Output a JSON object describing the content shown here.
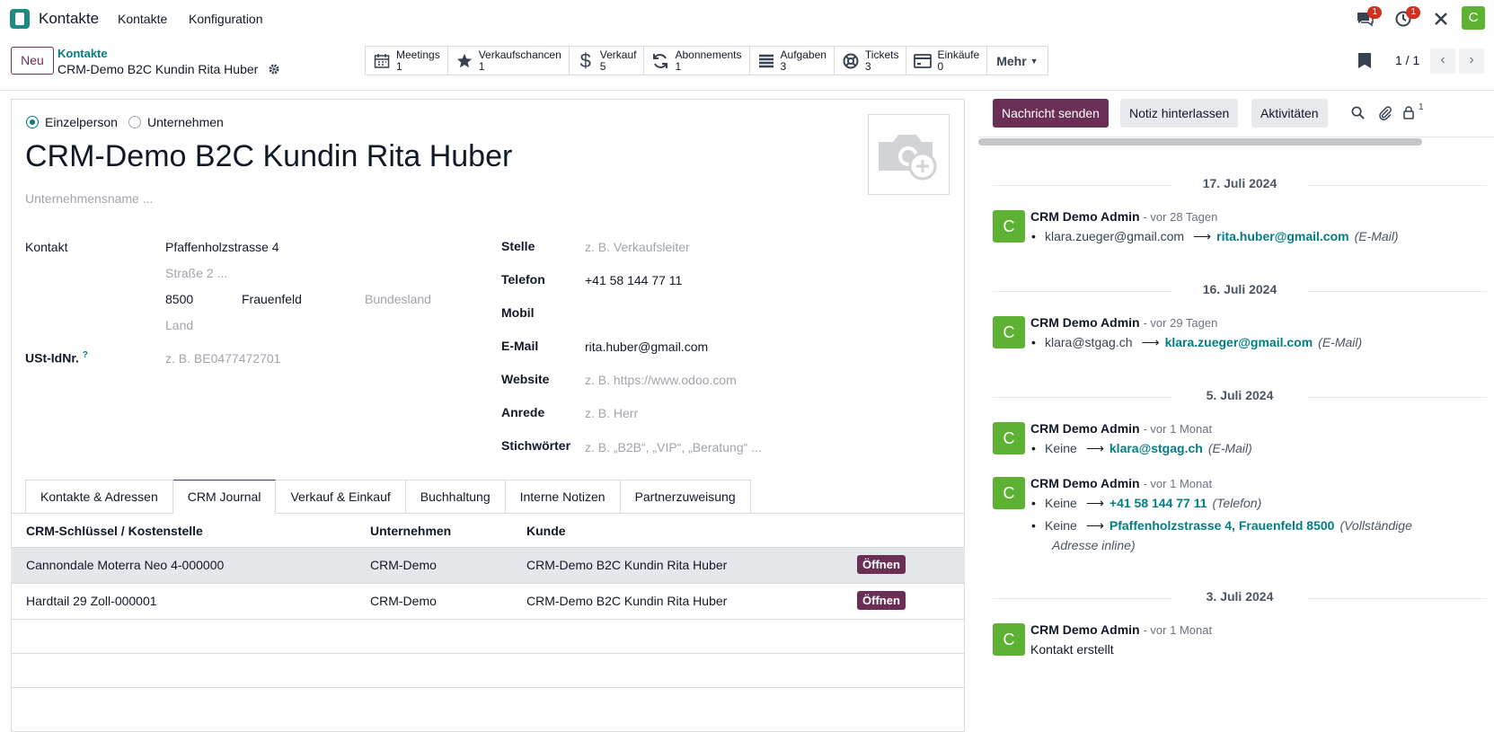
{
  "nav": {
    "app_name": "Kontakte",
    "menu": [
      "Kontakte",
      "Konfiguration"
    ],
    "messages_badge": "1",
    "activity_badge": "1",
    "user_initial": "C"
  },
  "control": {
    "new_label": "Neu",
    "breadcrumb_parent": "Kontakte",
    "breadcrumb_current": "CRM-Demo B2C Kundin Rita Huber",
    "smart_buttons": [
      {
        "label": "Meetings",
        "count": "1",
        "icon": "calendar-icon"
      },
      {
        "label": "Verkaufschancen",
        "count": "1",
        "icon": "star-icon"
      },
      {
        "label": "Verkauf",
        "count": "5",
        "icon": "dollar-icon"
      },
      {
        "label": "Abonnements",
        "count": "1",
        "icon": "refresh-icon"
      },
      {
        "label": "Aufgaben",
        "count": "3",
        "icon": "tasks-icon"
      },
      {
        "label": "Tickets",
        "count": "3",
        "icon": "lifebuoy-icon"
      },
      {
        "label": "Einkäufe",
        "count": "0",
        "icon": "credit-card-icon"
      }
    ],
    "more_label": "Mehr",
    "pager": "1 / 1"
  },
  "form": {
    "type_individual": "Einzelperson",
    "type_company": "Unternehmen",
    "name": "CRM-Demo B2C Kundin Rita Huber",
    "company_placeholder": "Unternehmensname ...",
    "contact_label": "Kontakt",
    "street": "Pfaffenholzstrasse 4",
    "street2_placeholder": "Straße 2 ...",
    "zip": "8500",
    "city": "Frauenfeld",
    "state_placeholder": "Bundesland",
    "country_placeholder": "Land",
    "vat_label": "USt-IdNr.",
    "vat_help": "?",
    "vat_placeholder": "z. B. BE0477472701",
    "job_label": "Stelle",
    "job_placeholder": "z. B. Verkaufsleiter",
    "phone_label": "Telefon",
    "phone": "+41 58 144 77 11",
    "mobile_label": "Mobil",
    "email_label": "E-Mail",
    "email": "rita.huber@gmail.com",
    "website_label": "Website",
    "website_placeholder": "z. B. https://www.odoo.com",
    "title_label": "Anrede",
    "title_placeholder": "z. B. Herr",
    "tags_label": "Stichwörter",
    "tags_placeholder": "z. B. „B2B“, „VIP“, „Beratung“ ..."
  },
  "tabs": [
    "Kontakte & Adressen",
    "CRM Journal",
    "Verkauf & Einkauf",
    "Buchhaltung",
    "Interne Notizen",
    "Partnerzuweisung"
  ],
  "active_tab": "CRM Journal",
  "table": {
    "headers": [
      "CRM-Schlüssel / Kostenstelle",
      "Unternehmen",
      "Kunde"
    ],
    "rows": [
      {
        "key": "Cannondale Moterra Neo 4-000000",
        "company": "CRM-Demo",
        "customer": "CRM-Demo B2C Kundin Rita Huber",
        "action": "Öffnen"
      },
      {
        "key": "Hardtail 29 Zoll-000001",
        "company": "CRM-Demo",
        "customer": "CRM-Demo B2C Kundin Rita Huber",
        "action": "Öffnen"
      }
    ]
  },
  "chatter": {
    "send_message": "Nachricht senden",
    "log_note": "Notiz hinterlassen",
    "activities": "Aktivitäten",
    "followers_count": "1",
    "groups": [
      {
        "date": "17. Juli 2024",
        "messages": [
          {
            "author": "CRM Demo Admin",
            "when": "- vor 28 Tagen",
            "tracking": [
              {
                "old": "klara.zueger@gmail.com",
                "new": "rita.huber@gmail.com",
                "field": "(E-Mail)"
              }
            ]
          }
        ]
      },
      {
        "date": "16. Juli 2024",
        "messages": [
          {
            "author": "CRM Demo Admin",
            "when": "- vor 29 Tagen",
            "tracking": [
              {
                "old": "klara@stgag.ch",
                "new": "klara.zueger@gmail.com",
                "field": "(E-Mail)"
              }
            ]
          }
        ]
      },
      {
        "date": "5. Juli 2024",
        "messages": [
          {
            "author": "CRM Demo Admin",
            "when": "- vor 1 Monat",
            "tracking": [
              {
                "old": "Keine",
                "new": "klara@stgag.ch",
                "field": "(E-Mail)"
              }
            ]
          },
          {
            "author": "CRM Demo Admin",
            "when": "- vor 1 Monat",
            "tracking": [
              {
                "old": "Keine",
                "new": "+41 58 144 77 11",
                "field": "(Telefon)"
              },
              {
                "old": "Keine",
                "new": "Pfaffenholzstrasse 4, Frauenfeld 8500",
                "field": "(Vollständige",
                "field_cont": "Adresse inline)"
              }
            ]
          }
        ]
      },
      {
        "date": "3. Juli 2024",
        "messages": [
          {
            "author": "CRM Demo Admin",
            "when": "- vor 1 Monat",
            "body": "Kontakt erstellt"
          }
        ]
      }
    ]
  },
  "colors": {
    "primary": "#6b2e55",
    "link": "#017e84",
    "avatar": "#5eb233"
  }
}
